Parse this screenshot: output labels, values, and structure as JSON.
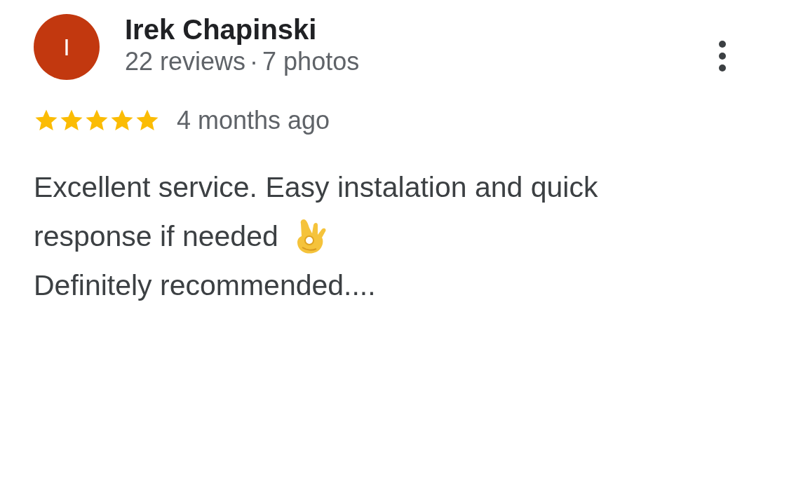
{
  "review": {
    "avatar_letter": "I",
    "author": "Irek Chapinski",
    "reviews": "22 reviews",
    "separator": "·",
    "photos": "7 photos",
    "stars": 5,
    "time": "4 months ago",
    "lines": [
      "Excellent service. Easy instalation and quick",
      "response if needed",
      "Definitely recommended...."
    ]
  }
}
